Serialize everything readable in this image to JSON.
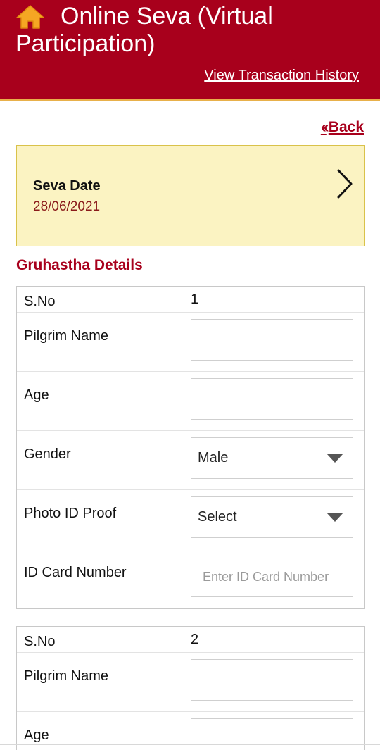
{
  "header": {
    "title": "Online Seva (Virtual Participation)",
    "history_link": "View Transaction History",
    "home_icon": "home-icon"
  },
  "nav": {
    "back_label": "Back",
    "back_icon": "double-chevron-left-icon"
  },
  "seva": {
    "label": "Seva Date",
    "date": "28/06/2021",
    "chevron_icon": "chevron-right-icon"
  },
  "section": {
    "title": "Gruhastha Details"
  },
  "pilgrims": [
    {
      "sno_label": "S.No",
      "sno": "1",
      "name_label": "Pilgrim Name",
      "name_value": "",
      "age_label": "Age",
      "age_value": "",
      "gender_label": "Gender",
      "gender_value": "Male",
      "photo_id_label": "Photo ID Proof",
      "photo_id_value": "Select",
      "id_number_label": "ID Card Number",
      "id_number_placeholder": "Enter ID Card Number"
    },
    {
      "sno_label": "S.No",
      "sno": "2",
      "name_label": "Pilgrim Name",
      "name_value": "",
      "age_label": "Age",
      "age_value": ""
    }
  ],
  "colors": {
    "header_bg": "#a8001c",
    "accent": "#a8001c",
    "seva_card_bg": "#fbf3c2",
    "home_icon_color": "#f5a623"
  }
}
